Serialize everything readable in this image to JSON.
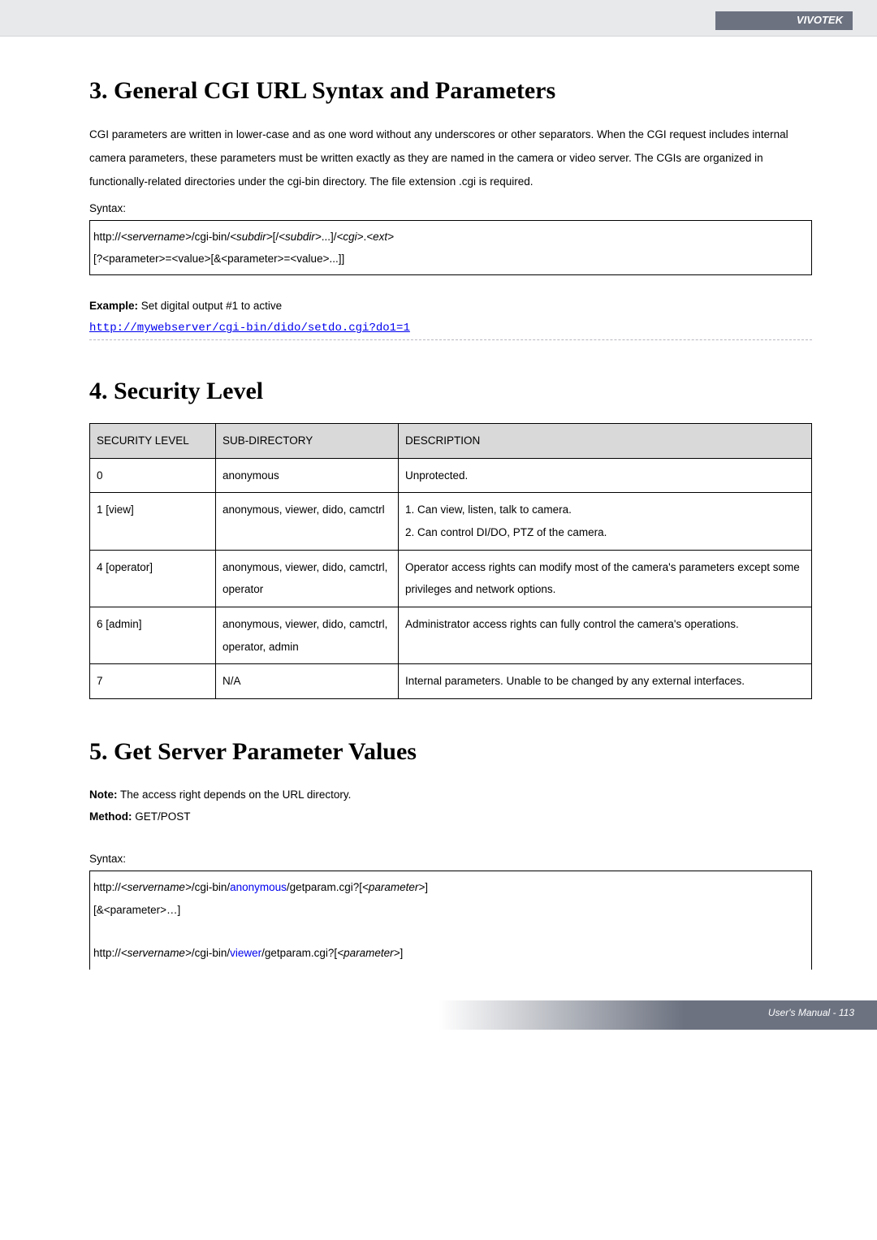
{
  "header": {
    "brand": "VIVOTEK"
  },
  "section3": {
    "title": "3. General CGI URL Syntax and Parameters",
    "paragraph": "CGI parameters are written in lower-case and as one word without any underscores or other separators. When the CGI request includes internal camera parameters, these parameters must be written exactly as they are named in the camera or video server. The CGIs are organized in functionally-related directories under the cgi-bin directory. The file extension .cgi is required.",
    "syntax_label": "Syntax:",
    "syntax_line1_a": "http://",
    "syntax_line1_b": "<servername>",
    "syntax_line1_c": "/cgi-bin/",
    "syntax_line1_d": "<subdir>",
    "syntax_line1_e": "[/",
    "syntax_line1_f": "<subdir>",
    "syntax_line1_g": "...]/",
    "syntax_line1_h": "<cgi>",
    "syntax_line1_i": ".",
    "syntax_line1_j": "<ext>",
    "syntax_line2": "[?<parameter>=<value>[&<parameter>=<value>...]]",
    "example_label": "Example:",
    "example_text": " Set digital output #1 to active",
    "example_url": "http://mywebserver/cgi-bin/dido/setdo.cgi?do1=1"
  },
  "section4": {
    "title": "4. Security Level",
    "headers": {
      "level": "SECURITY LEVEL",
      "subdir": "SUB-DIRECTORY",
      "desc": "DESCRIPTION"
    },
    "rows": [
      {
        "level": "0",
        "subdir": "anonymous",
        "desc": "Unprotected."
      },
      {
        "level": "1 [view]",
        "subdir": "anonymous, viewer, dido, camctrl",
        "desc": "1. Can view, listen, talk to camera.\n2. Can control DI/DO, PTZ of the camera."
      },
      {
        "level": "4 [operator]",
        "subdir": "anonymous, viewer, dido, camctrl, operator",
        "desc": "Operator access rights can modify most of the camera's parameters except some privileges and network options."
      },
      {
        "level": "6 [admin]",
        "subdir": "anonymous, viewer, dido, camctrl, operator, admin",
        "desc": "Administrator access rights can fully control the camera's operations."
      },
      {
        "level": "7",
        "subdir": "N/A",
        "desc": "Internal parameters. Unable to be changed by any external interfaces."
      }
    ]
  },
  "section5": {
    "title": "5. Get Server Parameter Values",
    "note_label": "Note:",
    "note_text": " The access right depends on the URL directory.",
    "method_label": "Method:",
    "method_text": " GET/POST",
    "syntax_label": "Syntax:",
    "box": {
      "l1a": "http://",
      "l1b": "<servername>",
      "l1c": "/cgi-bin/",
      "l1d": "anonymous",
      "l1e": "/getparam.cgi?[",
      "l1f": "<parameter>",
      "l1g": "]",
      "l2": "[&<parameter>…]",
      "l3a": "http://",
      "l3b": "<servername>",
      "l3c": "/cgi-bin/",
      "l3d": "viewer",
      "l3e": "/getparam.cgi?[",
      "l3f": "<parameter>",
      "l3g": "]"
    }
  },
  "footer": {
    "text": "User's Manual - 113"
  }
}
